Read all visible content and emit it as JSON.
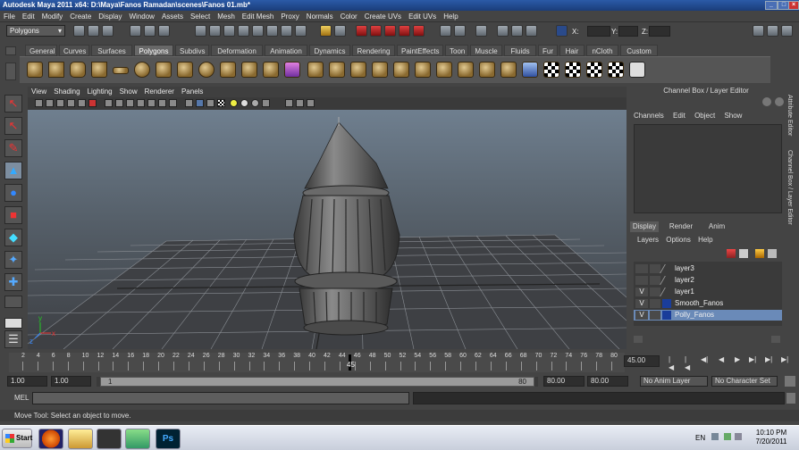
{
  "window": {
    "title": "Autodesk Maya 2011 x64: D:\\Maya\\Fanos Ramadan\\scenes\\Fanos 01.mb*"
  },
  "menubar": {
    "items": [
      "File",
      "Edit",
      "Modify",
      "Create",
      "Display",
      "Window",
      "Assets",
      "Select",
      "Mesh",
      "Edit Mesh",
      "Proxy",
      "Normals",
      "Color",
      "Create UVs",
      "Edit UVs",
      "Help"
    ]
  },
  "statusline": {
    "mode": "Polygons",
    "x_label": "X:",
    "y_label": "Y:",
    "z_label": "Z:"
  },
  "shelf": {
    "tabs": [
      "General",
      "Curves",
      "Surfaces",
      "Polygons",
      "Subdivs",
      "Deformation",
      "Animation",
      "Dynamics",
      "Rendering",
      "PaintEffects",
      "Toon",
      "Muscle",
      "Fluids",
      "Fur",
      "Hair",
      "nCloth",
      "Custom"
    ],
    "active": "Polygons"
  },
  "panel": {
    "menu": [
      "View",
      "Shading",
      "Lighting",
      "Show",
      "Renderer",
      "Panels"
    ]
  },
  "channelbox": {
    "header": "Channel Box / Layer Editor",
    "menu": [
      "Channels",
      "Edit",
      "Object",
      "Show"
    ],
    "side_tabs": [
      "Attribute Editor",
      "Channel Box / Layer Editor"
    ]
  },
  "layers": {
    "tabs": [
      "Display",
      "Render",
      "Anim"
    ],
    "menu": [
      "Layers",
      "Options",
      "Help"
    ],
    "items": [
      {
        "name": "layer3",
        "visible": "",
        "color": "",
        "selected": false
      },
      {
        "name": "layer2",
        "visible": "",
        "color": "",
        "selected": false
      },
      {
        "name": "layer1",
        "visible": "V",
        "color": "",
        "selected": false
      },
      {
        "name": "Smooth_Fanos",
        "visible": "V",
        "color": "#1a3d9a",
        "selected": false
      },
      {
        "name": "Polly_Fanos",
        "visible": "V",
        "color": "#1a3d9a",
        "selected": true
      }
    ]
  },
  "timeline": {
    "ticks": [
      "2",
      "4",
      "6",
      "8",
      "10",
      "12",
      "14",
      "16",
      "18",
      "20",
      "22",
      "24",
      "26",
      "28",
      "30",
      "32",
      "34",
      "36",
      "38",
      "40",
      "42",
      "44",
      "46",
      "48",
      "50",
      "52",
      "54",
      "56",
      "58",
      "60",
      "62",
      "64",
      "66",
      "68",
      "70",
      "72",
      "74",
      "76",
      "78",
      "80"
    ],
    "current_frame_label": "45",
    "current_frame": "45.00"
  },
  "range": {
    "start": "1.00",
    "playback_start": "1.00",
    "slider_start": "1",
    "slider_end": "80",
    "playback_end": "80.00",
    "end": "80.00",
    "anim_layer": "No Anim Layer",
    "character_set": "No Character Set"
  },
  "cmd": {
    "label": "MEL"
  },
  "help": {
    "text": "Move Tool: Select an object to move."
  },
  "taskbar": {
    "start": "Start",
    "lang": "EN",
    "time": "10:10 PM",
    "date": "7/20/2011",
    "ps_label": "Ps"
  },
  "viewport": {
    "axis_x": "x",
    "axis_y": "y",
    "axis_z": "z"
  }
}
